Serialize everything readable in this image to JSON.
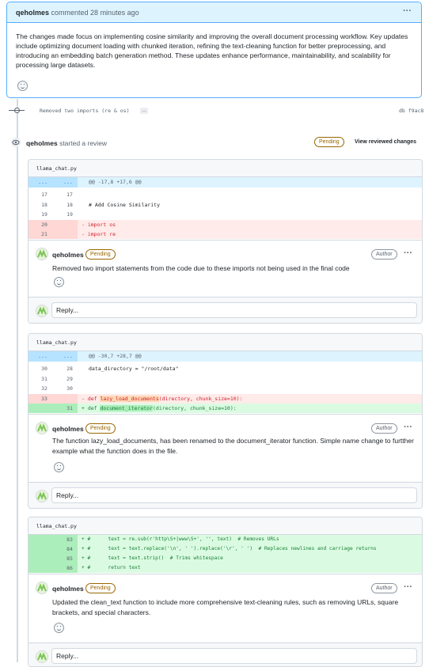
{
  "top_comment": {
    "author": "qeholmes",
    "action": "commented 28 minutes ago",
    "body": "The changes made focus on implementing cosine similarity and improving the overall document processing workflow. Key updates include optimizing document loading with chunked iteration, refining the text-cleaning function for better preprocessing, and introducing an embedding batch generation method. These updates enhance performance, maintainability, and scalability for processing large datasets."
  },
  "commit": {
    "message": "Removed two imports (re & os)",
    "ellipsis": "…",
    "sha": "db f9ac8"
  },
  "review": {
    "author": "qeholmes",
    "action": "started a review",
    "pending": "Pending",
    "view_reviewed": "View reviewed changes"
  },
  "threads": [
    {
      "file": "llama_chat.py",
      "hunk": "@@ -17,8 +17,6 @@",
      "rows": [
        {
          "old": "17",
          "new": "17",
          "code": ""
        },
        {
          "old": "18",
          "new": "18",
          "code": "# Add Cosine Similarity"
        },
        {
          "old": "19",
          "new": "19",
          "code": ""
        },
        {
          "old": "20",
          "new": "",
          "code": "- import os"
        },
        {
          "old": "21",
          "new": "",
          "code": "- import re"
        }
      ],
      "author": "qeholmes",
      "pending": "Pending",
      "author_badge": "Author",
      "comment": "Removed two import statements from the code due to these imports not being used in the final code",
      "reply": "Reply..."
    },
    {
      "file": "llama_chat.py",
      "hunk": "@@ -30,7 +28,7 @@",
      "rows": [
        {
          "old": "30",
          "new": "28",
          "code": "data_directory = \"/root/data\""
        },
        {
          "old": "31",
          "new": "29",
          "code": ""
        },
        {
          "old": "32",
          "new": "30",
          "code": ""
        },
        {
          "old": "33",
          "new": "",
          "code_pre": "- def ",
          "code_hl": "lazy_load_documents",
          "code_post": "(directory, chunk_size=10):"
        },
        {
          "old": "",
          "new": "31",
          "code_pre": "+ def ",
          "code_hl": "document_iterator",
          "code_post": "(directory, chunk_size=10):"
        }
      ],
      "author": "qeholmes",
      "pending": "Pending",
      "author_badge": "Author",
      "comment": "The function lazy_load_documents, has been renamed to the document_iterator function. Simple name change to furtther example what the function does in the file.",
      "reply": "Reply..."
    },
    {
      "file": "llama_chat.py",
      "rows": [
        {
          "new": "83",
          "code": "+ #      text = re.sub(r'http\\S+|www\\S+', '', text)  # Removes URLs"
        },
        {
          "new": "84",
          "code": "+ #      text = text.replace('\\n', ' ').replace('\\r', ' ')  # Replaces newlines and carriage returns"
        },
        {
          "new": "85",
          "code": "+ #      text = text.strip()  # Trims whitespace"
        },
        {
          "new": "86",
          "code": "+ #      return text"
        }
      ],
      "author": "qeholmes",
      "pending": "Pending",
      "author_badge": "Author",
      "comment": "Updated the clean_text function to include more comprehensive text-cleaning rules, such as removing URLs, square brackets, and special characters.",
      "reply": "Reply..."
    }
  ],
  "icons": {
    "dots": "···",
    "hunk_dots": "..."
  }
}
